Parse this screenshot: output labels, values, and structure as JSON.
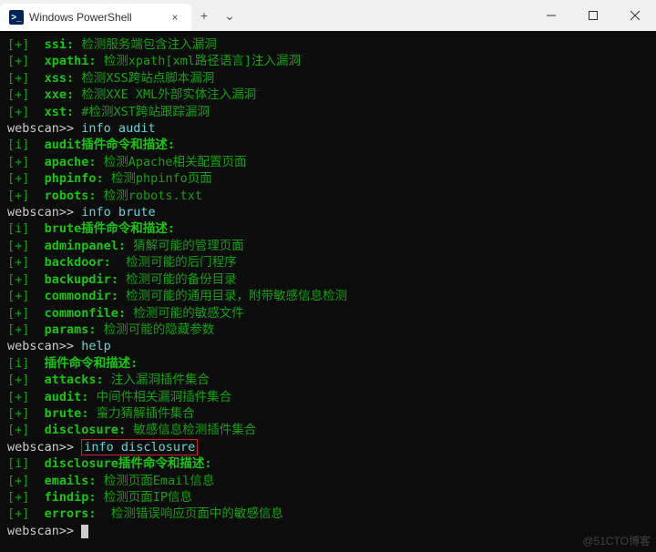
{
  "window": {
    "tab_title": "Windows PowerShell",
    "tab_close": "×",
    "new_tab": "+",
    "dropdown": "⌄",
    "minimize": "—",
    "maximize": "□",
    "close": "×"
  },
  "term": {
    "tags": {
      "plus": "[+]",
      "info": "[i]"
    },
    "prompt": "webscan>>",
    "cmd_info_audit": "info audit",
    "cmd_info_brute": "info brute",
    "cmd_help": "help",
    "cmd_info_disclosure": "info disclosure",
    "blocks": {
      "initial": [
        {
          "k": "ssi:",
          "d": "检测服务端包含注入漏洞"
        },
        {
          "k": "xpathi:",
          "d": "检测xpath[xml路径语言]注入漏洞"
        },
        {
          "k": "xss:",
          "d": "检测XSS跨站点脚本漏洞"
        },
        {
          "k": "xxe:",
          "d": "检测XXE XML外部实体注入漏洞"
        },
        {
          "k": "xst:",
          "d": "#检测XST跨站跟踪漏洞"
        }
      ],
      "audit_header": "audit插件命令和描述:",
      "audit": [
        {
          "k": "apache:",
          "d": "检测Apache相关配置页面"
        },
        {
          "k": "phpinfo:",
          "d": "检测phpinfo页面"
        },
        {
          "k": "robots:",
          "d": "检测robots.txt"
        }
      ],
      "brute_header": "brute插件命令和描述:",
      "brute": [
        {
          "k": "adminpanel:",
          "d": "猜解可能的管理页面"
        },
        {
          "k": "backdoor:",
          "d": " 检测可能的后门程序"
        },
        {
          "k": "backupdir:",
          "d": "检测可能的备份目录"
        },
        {
          "k": "commondir:",
          "d": "检测可能的通用目录，附带敏感信息检测"
        },
        {
          "k": "commonfile:",
          "d": "检测可能的敏感文件"
        },
        {
          "k": "params:",
          "d": "检测可能的隐藏参数"
        }
      ],
      "help_header": "插件命令和描述:",
      "help": [
        {
          "k": "attacks:",
          "d": "注入漏洞插件集合"
        },
        {
          "k": "audit:",
          "d": "中间件相关漏洞插件集合"
        },
        {
          "k": "brute:",
          "d": "蛮力猜解插件集合"
        },
        {
          "k": "disclosure:",
          "d": "敏感信息检测插件集合"
        }
      ],
      "disclosure_header": "disclosure插件命令和描述:",
      "disclosure": [
        {
          "k": "emails:",
          "d": "检测页面Email信息"
        },
        {
          "k": "findip:",
          "d": "检测页面IP信息"
        },
        {
          "k": "errors:",
          "d": " 检测错误响应页面中的敏感信息"
        }
      ]
    }
  },
  "watermark": "@51CTO博客"
}
